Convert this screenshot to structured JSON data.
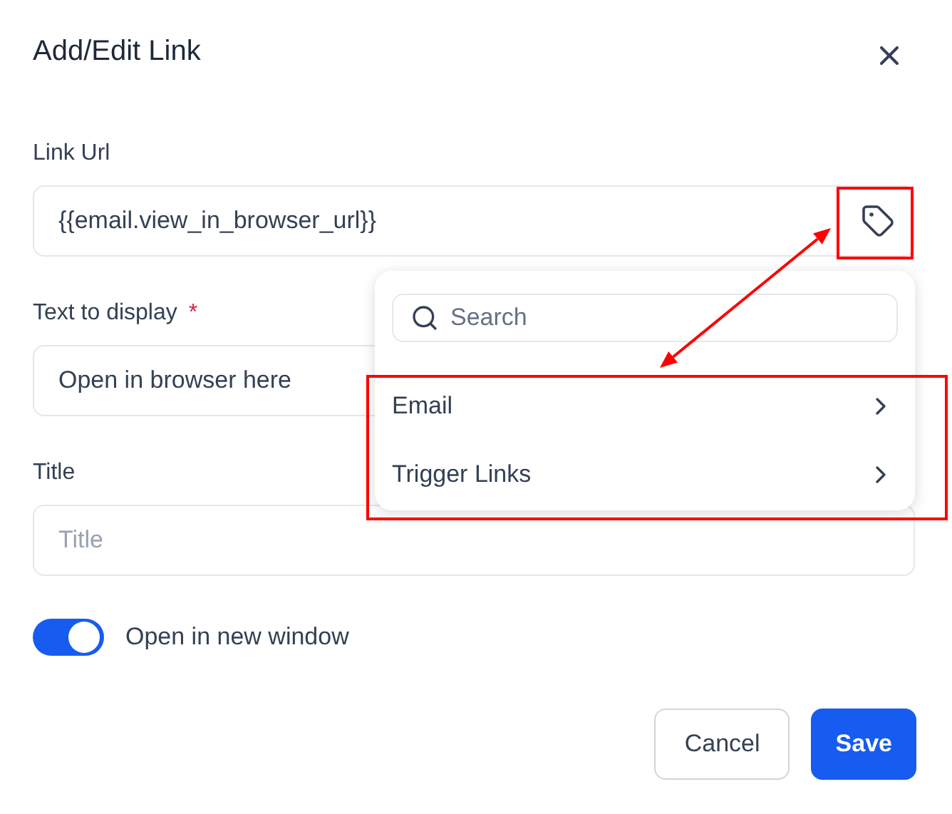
{
  "dialog": {
    "title": "Add/Edit Link"
  },
  "fields": [
    {
      "label": "Link Url",
      "kind": "tag",
      "value": "{{email.view_in_browser_url}}"
    },
    {
      "label": "Text to display",
      "kind": "text",
      "required_mark": "*",
      "value": "Open in browser here"
    },
    {
      "label": "Title",
      "kind": "text",
      "placeholder": "Title"
    }
  ],
  "toggle": {
    "label": "Open in new window",
    "on": true
  },
  "buttons": [
    {
      "label": "Cancel",
      "kind": "secondary"
    },
    {
      "label": "Save",
      "kind": "primary"
    }
  ],
  "dropdown": {
    "search": {
      "placeholder": "Search"
    },
    "items": [
      {
        "label": "Email"
      },
      {
        "label": "Trigger Links"
      }
    ]
  }
}
